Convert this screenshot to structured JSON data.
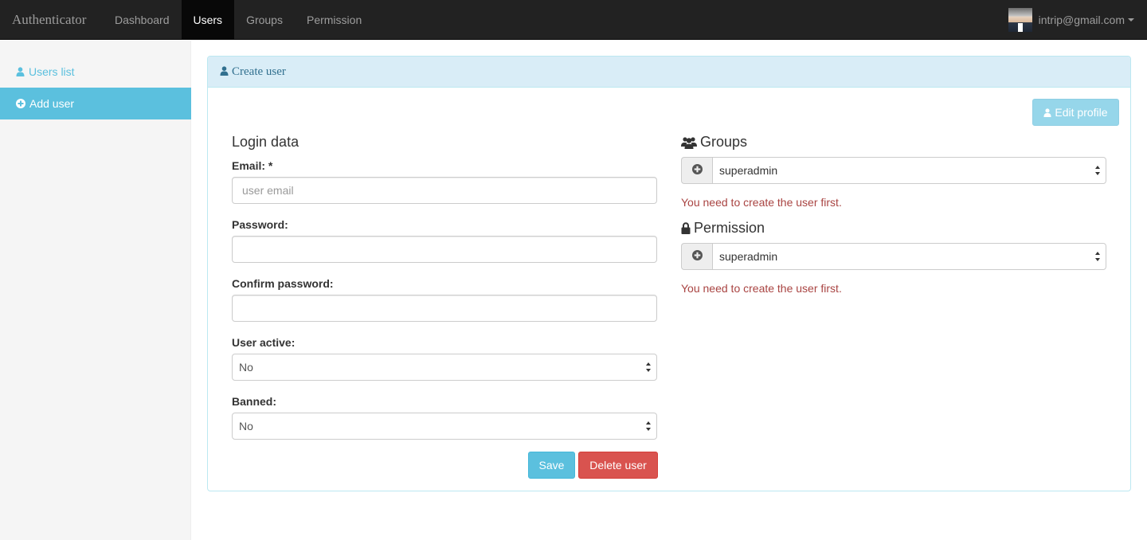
{
  "app": {
    "brand": "Authenticator"
  },
  "nav": {
    "items": [
      {
        "label": "Dashboard",
        "active": false
      },
      {
        "label": "Users",
        "active": true
      },
      {
        "label": "Groups",
        "active": false
      },
      {
        "label": "Permission",
        "active": false
      }
    ],
    "user_email": "intrip@gmail.com"
  },
  "sidebar": {
    "items": [
      {
        "label": "Users list",
        "icon": "user-icon",
        "active": false
      },
      {
        "label": "Add user",
        "icon": "plus-circle-icon",
        "active": true
      }
    ]
  },
  "panel": {
    "title": "Create user",
    "edit_profile_label": "Edit profile"
  },
  "login": {
    "heading": "Login data",
    "email_label": "Email: *",
    "email_placeholder": "user email",
    "email_value": "",
    "password_label": "Password:",
    "confirm_label": "Confirm password:",
    "active_label": "User active:",
    "active_value": "No",
    "banned_label": "Banned:",
    "banned_value": "No",
    "save_label": "Save",
    "delete_label": "Delete user"
  },
  "groups": {
    "heading": "Groups",
    "selected": "superadmin",
    "error": "You need to create the user first."
  },
  "permission": {
    "heading": "Permission",
    "selected": "superadmin",
    "error": "You need to create the user first."
  },
  "colors": {
    "navbar": "#222222",
    "info": "#5bc0de",
    "danger": "#d9534f",
    "panel_heading": "#d9edf7",
    "error_text": "#a94442"
  }
}
